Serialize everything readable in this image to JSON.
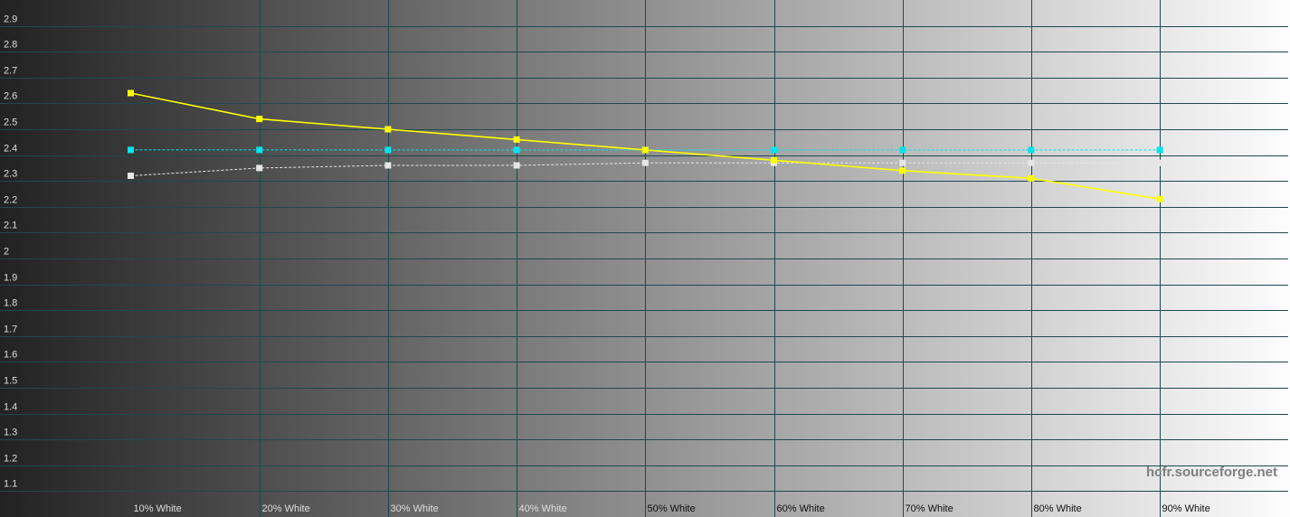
{
  "chart_data": {
    "type": "line",
    "categories": [
      "10% White",
      "20% White",
      "30% White",
      "40% White",
      "50% White",
      "60% White",
      "70% White",
      "80% White",
      "90% White"
    ],
    "ylim": [
      1.0,
      3.0
    ],
    "yticks": [
      1.1,
      1.2,
      1.3,
      1.4,
      1.5,
      1.6,
      1.7,
      1.8,
      1.9,
      2,
      2.1,
      2.2,
      2.3,
      2.4,
      2.5,
      2.6,
      2.7,
      2.8,
      2.9
    ],
    "grid": true,
    "series": [
      {
        "color": "#ffff00",
        "line_style": "solid",
        "values": [
          2.64,
          2.54,
          2.5,
          2.46,
          2.42,
          2.38,
          2.34,
          2.31,
          2.23
        ]
      },
      {
        "color": "#00e5ee",
        "line_style": "dashed",
        "values": [
          2.42,
          2.42,
          2.42,
          2.42,
          2.42,
          2.42,
          2.42,
          2.42,
          2.42
        ]
      },
      {
        "color": "#e6e6e6",
        "line_style": "dashed",
        "values": [
          2.32,
          2.35,
          2.36,
          2.36,
          2.37,
          2.37,
          2.37,
          2.37,
          2.37
        ]
      }
    ]
  },
  "watermark": "hcfr.sourceforge.net",
  "colors": {
    "grid": "#1d4a4e",
    "background_dark": "#222222",
    "background_light": "#fdfdfd"
  }
}
